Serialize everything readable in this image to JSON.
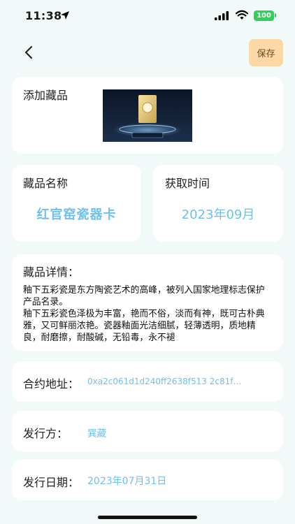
{
  "status_bar": {
    "time": "11:38",
    "battery": "100"
  },
  "header": {
    "save_label": "保存"
  },
  "cover": {
    "label": "添加藏品",
    "image_caption": "红官窑瓷器卡"
  },
  "name": {
    "label": "藏品名称",
    "value": "红官窑瓷器卡"
  },
  "acquire": {
    "label": "获取时间",
    "value": "2023年09月"
  },
  "detail": {
    "label": "藏品详情：",
    "text": "釉下五彩瓷是东方陶瓷艺术的高峰，被列入国家地理标志保护产品名录。\n釉下五彩瓷色泽极为丰富，艳而不俗，淡而有神，既可古朴典雅，又可鲜丽浓艳。瓷器釉面光洁细腻，轻薄透明，质地精良，耐磨擦，耐酸碱，无铅毒，永不褪"
  },
  "contract": {
    "label": "合约地址：",
    "value": "0xa2c061d1d240ff2638f513 2c81f…"
  },
  "issuer": {
    "label": "发行方：",
    "value": "巽藏"
  },
  "issue_date": {
    "label": "发行日期：",
    "value": "2023年07月31日"
  },
  "colors": {
    "background": "#f2faf9",
    "accent_blue": "#6ec1ee",
    "save_button": "#fbd8a5",
    "battery": "#2fd157"
  }
}
